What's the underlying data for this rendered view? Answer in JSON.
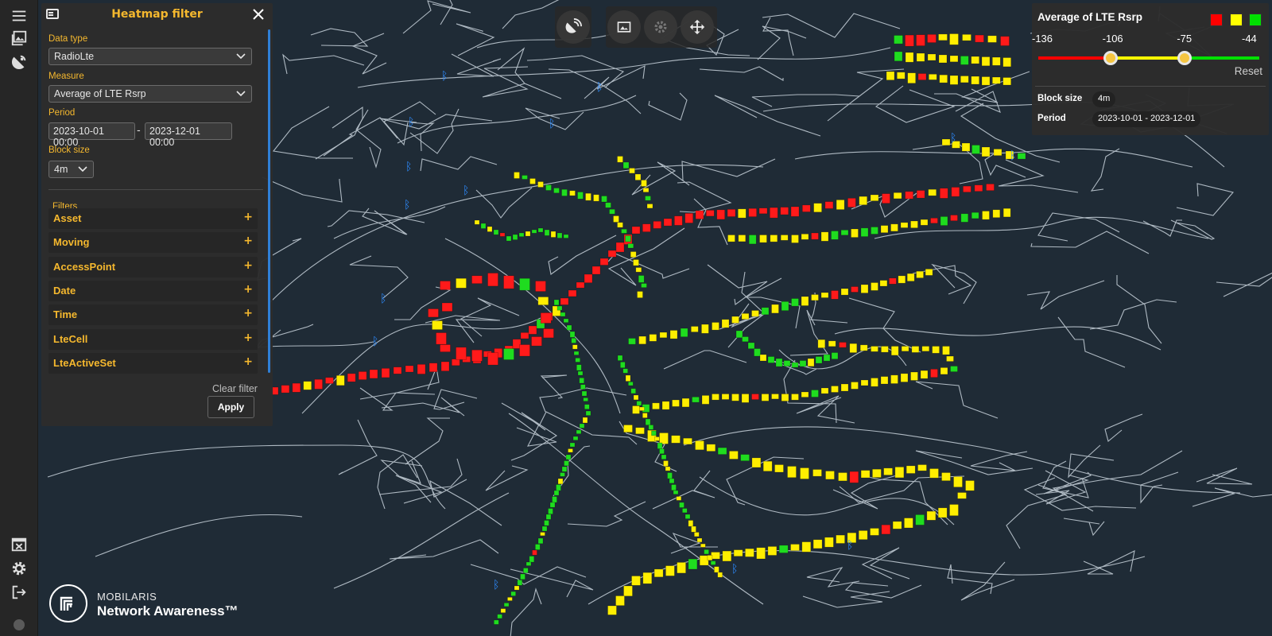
{
  "rail": {
    "top_icons": [
      "menu-icon",
      "image-gallery-icon",
      "satellite-icon"
    ],
    "bottom_icons": [
      "table-close-icon",
      "gear-icon",
      "logout-icon"
    ]
  },
  "filter_panel": {
    "title": "Heatmap filter",
    "data_type_label": "Data type",
    "data_type_value": "RadioLte",
    "measure_label": "Measure",
    "measure_value": "Average of LTE Rsrp",
    "period_label": "Period",
    "period_start": "2023-10-01 00:00",
    "period_separator": "-",
    "period_end": "2023-12-01 00:00",
    "block_size_label": "Block size",
    "block_size_value": "4m",
    "filters_label": "Filters",
    "filter_groups": [
      {
        "name": "Asset",
        "icon": "+"
      },
      {
        "name": "Moving",
        "icon": "+"
      },
      {
        "name": "AccessPoint",
        "icon": "+"
      },
      {
        "name": "Date",
        "icon": "+"
      },
      {
        "name": "Time",
        "icon": "+"
      },
      {
        "name": "LteCell",
        "icon": "+"
      },
      {
        "name": "LteActiveSet",
        "icon": "+"
      }
    ],
    "clear_filter": "Clear filter",
    "apply": "Apply"
  },
  "toolbar": {
    "buttons": [
      "satellite-antenna-icon",
      "image-icon",
      "settings-cog-icon",
      "move-arrows-icon"
    ]
  },
  "legend": {
    "title": "Average of LTE Rsrp",
    "swatch_colors": [
      "#ff0000",
      "#ffff00",
      "#00e000"
    ],
    "ticks": [
      "-136",
      "-106",
      "-75",
      "-44"
    ],
    "thresholds": [
      -106,
      -75
    ],
    "range": [
      -136,
      -44
    ],
    "reset": "Reset",
    "block_size_label": "Block size",
    "block_size_value": "4m",
    "period_label": "Period",
    "period_value": "2023-10-01 - 2023-12-01"
  },
  "brand": {
    "company": "MOBILARIS",
    "product": "Network Awareness™"
  },
  "colors": {
    "accent": "#f5b82e",
    "map_background": "#1f2b36",
    "road_lines": "#c9d3dc",
    "signal_bad": "#ff1a1a",
    "signal_medium": "#ffee00",
    "signal_good": "#1fdc1f"
  }
}
